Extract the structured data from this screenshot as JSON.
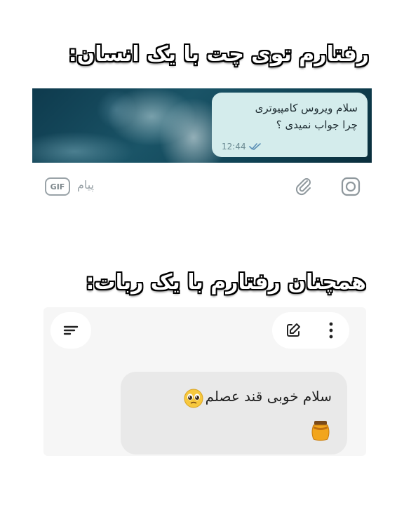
{
  "captions": {
    "top": "رفتارم توی چت با یک انسان:",
    "bottom": "همچنان رفتارم با یک ربات:"
  },
  "human_chat": {
    "message_lines": [
      "سلام ویروس کامپیوتری",
      "چرا جواب نمیدی ؟"
    ],
    "time": "12:44",
    "status_icon": "double-check-icon",
    "input": {
      "placeholder": "پیام",
      "gif_label": "GIF",
      "icons": [
        "attach-icon",
        "camera-icon"
      ]
    },
    "colors": {
      "bubble": "#d4ecec",
      "background": "#0f4254"
    }
  },
  "bot_chat": {
    "message": "سلام خوبی قند عصلم",
    "emoji_icons": [
      "pleading-face-icon",
      "honey-pot-icon"
    ],
    "toolbar_icons": [
      "menu-icon",
      "edit-icon",
      "more-vertical-icon"
    ],
    "colors": {
      "bubble": "#e9e9e9",
      "panel": "#f6f6f6"
    }
  }
}
